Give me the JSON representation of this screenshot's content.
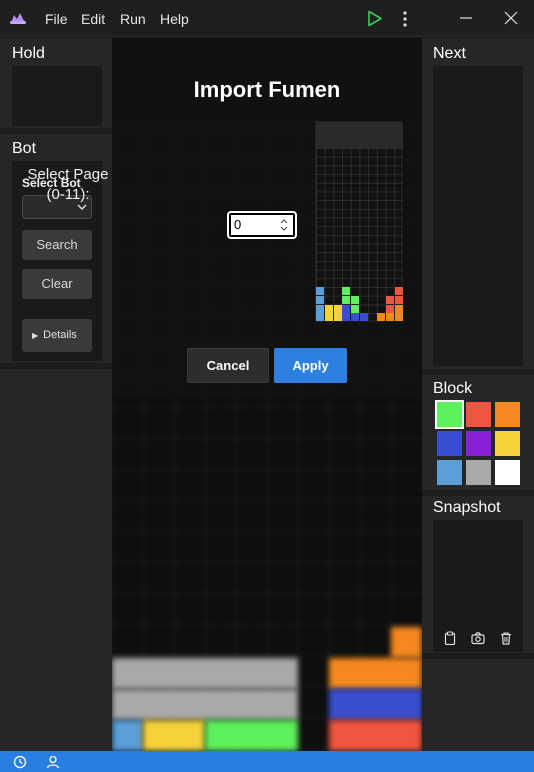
{
  "menu": {
    "file": "File",
    "edit": "Edit",
    "run": "Run",
    "help": "Help"
  },
  "hold": {
    "title": "Hold"
  },
  "bot": {
    "title": "Bot",
    "select_label": "Select Bot",
    "selected": "",
    "search": "Search",
    "clear": "Clear",
    "details": "Details"
  },
  "next": {
    "title": "Next"
  },
  "block": {
    "title": "Block",
    "colors": [
      "#5ef05e",
      "#f0553f",
      "#f5891f",
      "#3a4fd0",
      "#8a1fd8",
      "#f5d23a",
      "#5a9fd8",
      "#a9a9a9",
      "#ffffff"
    ],
    "selected": 0
  },
  "snapshot": {
    "title": "Snapshot"
  },
  "dialog": {
    "title": "Import Fumen",
    "page_label_line1": "Select Page",
    "page_label_line2": "(0-11):",
    "page_value": "0",
    "cancel": "Cancel",
    "apply": "Apply"
  },
  "icons": {
    "app": "cloud-logo-icon",
    "run": "play-icon",
    "more": "more-vertical-icon",
    "minimize": "minimize-icon",
    "close": "close-icon",
    "snapshot_tools": [
      "clipboard-icon",
      "camera-icon",
      "trash-icon"
    ],
    "status": [
      "history-icon",
      "account-icon"
    ]
  },
  "colors": {
    "accent": "#2d7fe0",
    "status_bar": "#2a7de1"
  }
}
